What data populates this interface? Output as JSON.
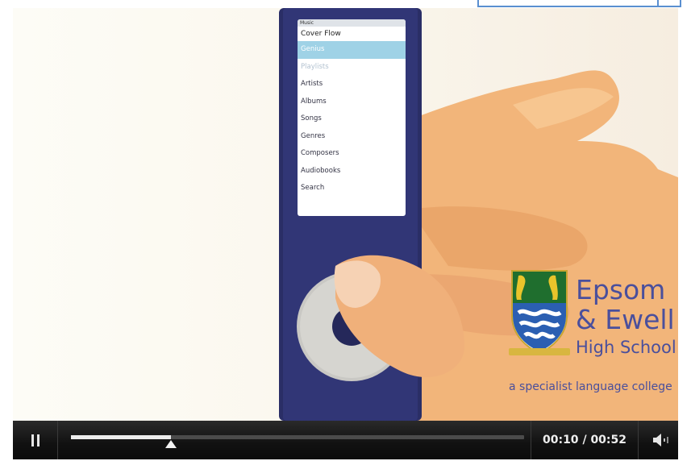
{
  "ipod_menu": {
    "status": "Music",
    "title": "Cover Flow",
    "items": [
      {
        "label": "Genius",
        "state": "selected"
      },
      {
        "label": "Playlists",
        "state": "faded"
      },
      {
        "label": "Artists",
        "state": "normal"
      },
      {
        "label": "Albums",
        "state": "normal"
      },
      {
        "label": "Songs",
        "state": "normal"
      },
      {
        "label": "Genres",
        "state": "normal"
      },
      {
        "label": "Composers",
        "state": "normal"
      },
      {
        "label": "Audiobooks",
        "state": "normal"
      },
      {
        "label": "Search",
        "state": "normal"
      }
    ]
  },
  "logo": {
    "line1": "Epsom",
    "line2": "& Ewell",
    "line3": "High School",
    "tagline": "a specialist language college",
    "color": "#4a4f9c"
  },
  "player": {
    "current_time": "00:10",
    "separator": "/",
    "duration": "00:52",
    "progress_fraction": 0.22,
    "pause_icon": "pause-icon",
    "volume_icon": "volume-icon"
  }
}
